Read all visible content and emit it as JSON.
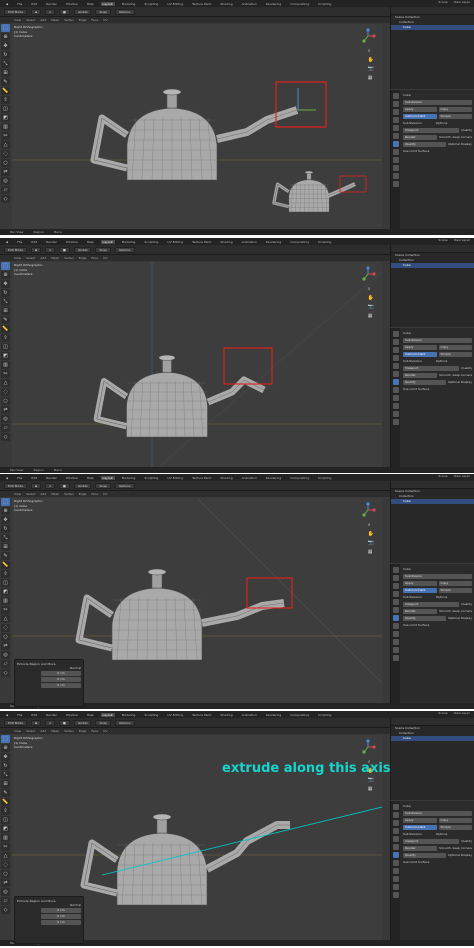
{
  "app": {
    "title": "Blender"
  },
  "menus": [
    "File",
    "Edit",
    "Render",
    "Window",
    "Help"
  ],
  "workspace_tabs": [
    "Layout",
    "Modeling",
    "Sculpting",
    "UV Editing",
    "Texture Paint",
    "Shading",
    "Animation",
    "Rendering",
    "Compositing",
    "Scripting"
  ],
  "top_right": {
    "scene": "Scene",
    "view_layer": "View Layer"
  },
  "viewport_header": {
    "mode": "Edit Mode",
    "orientation": "Global",
    "snap": "Snap",
    "options": "Options"
  },
  "panels": [
    {
      "info": [
        "Right Orthographic",
        "(1) Cube",
        "Centimeters"
      ],
      "show_operator": false
    },
    {
      "info": [
        "Right Orthographic",
        "(1) Cube",
        "Centimeters"
      ],
      "show_operator": false
    },
    {
      "info": [
        "Right Orthographic",
        "(1) Cube",
        "Centimeters"
      ],
      "show_operator": true
    },
    {
      "info": [
        "Right Orthographic",
        "(1) Cube",
        "Centimeters"
      ],
      "show_operator": true
    }
  ],
  "outliner": {
    "items": [
      "Scene Collection",
      "Collection",
      "Cube"
    ]
  },
  "properties": {
    "object": "Cube",
    "modifier": "Subdivision",
    "buttons": [
      "Apply",
      "Copy"
    ],
    "type": [
      "Catmull-Clark",
      "Simple"
    ],
    "subdivisions_label": "Subdivisions",
    "options_label": "Options",
    "viewport": "Viewport",
    "render": "Render",
    "quality": "Quality",
    "opt_quality": "Quality",
    "opt_uv": "Smooth, keep corners",
    "opt_opti": "Optimal Display",
    "opt_cage": "Use Limit Surface"
  },
  "operator_panel": {
    "title": "Extrude Region and Move",
    "orientation": "Normal",
    "move_x": "Move X",
    "move_y": "Y",
    "move_z": "Z",
    "val": "0 cm"
  },
  "annotation": "extrude along this axis",
  "status_bar": [
    "Pan View",
    "Region",
    "Menu"
  ],
  "colors": {
    "selection_box": "#e2211c",
    "teal_line": "#00c7c7",
    "accent": "#4772b3"
  }
}
